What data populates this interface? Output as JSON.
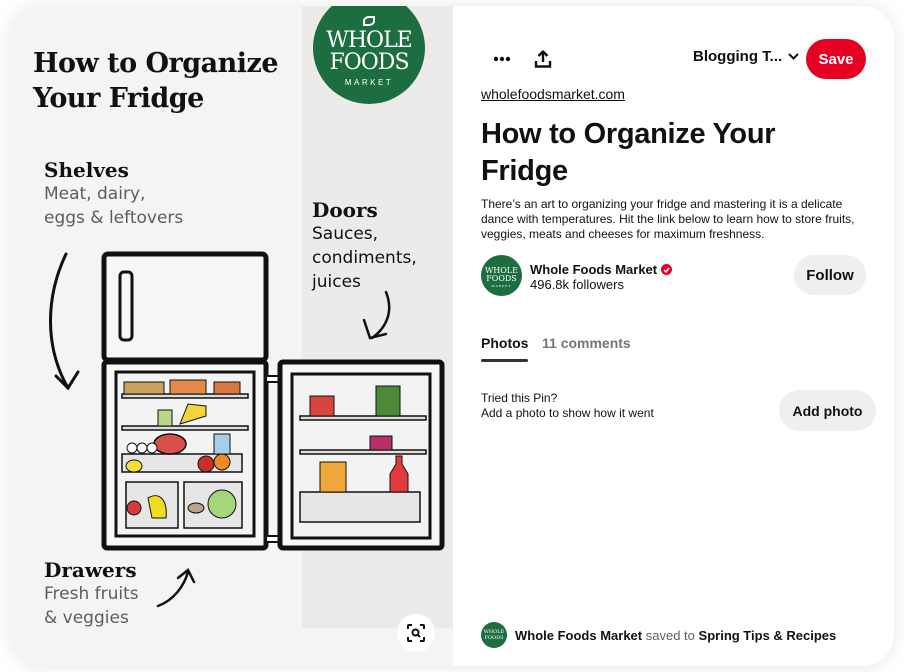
{
  "pin_image": {
    "title_line1": "How to Organize",
    "title_line2": "Your Fridge",
    "logo": {
      "line1": "WHOLE",
      "line2": "FOODS",
      "line3": "MARKET"
    },
    "shelves": {
      "heading": "Shelves",
      "line1": "Meat, dairy,",
      "line2": "eggs & leftovers"
    },
    "doors": {
      "heading": "Doors",
      "line1": "Sauces,",
      "line2": "condiments,",
      "line3": "juices"
    },
    "drawers": {
      "heading": "Drawers",
      "line1": "Fresh fruits",
      "line2": "& veggies"
    },
    "visual_search_icon": "lens-icon"
  },
  "toolbar": {
    "more_icon": "ellipsis-icon",
    "share_icon": "share-upload-icon",
    "board_select": "Blogging T...",
    "save_label": "Save"
  },
  "pin": {
    "source_link": "wholefoodsmarket.com",
    "title": "How to Organize Your Fridge",
    "description": "There’s an art to organizing your fridge and mastering it is a delicate dance with temperatures. Hit the link below to learn how to store fruits, veggies, meats and cheeses for maximum freshness."
  },
  "creator": {
    "name": "Whole Foods Market",
    "verified": true,
    "followers": "496.8k followers",
    "follow_label": "Follow",
    "avatar": {
      "line1": "WHOLE",
      "line2": "FOODS",
      "line3": "MARKET"
    }
  },
  "tabs": [
    {
      "label": "Photos",
      "active": true
    },
    {
      "label": "11 comments",
      "active": false
    }
  ],
  "tried": {
    "line1": "Tried this Pin?",
    "line2": "Add a photo to show how it went",
    "button_label": "Add photo"
  },
  "saved": {
    "user": "Whole Foods Market",
    "verb": "saved to",
    "board": "Spring Tips & Recipes"
  },
  "colors": {
    "brand_red": "#e60023",
    "wfm_green": "#1c6d3f",
    "button_gray": "#efefef"
  }
}
